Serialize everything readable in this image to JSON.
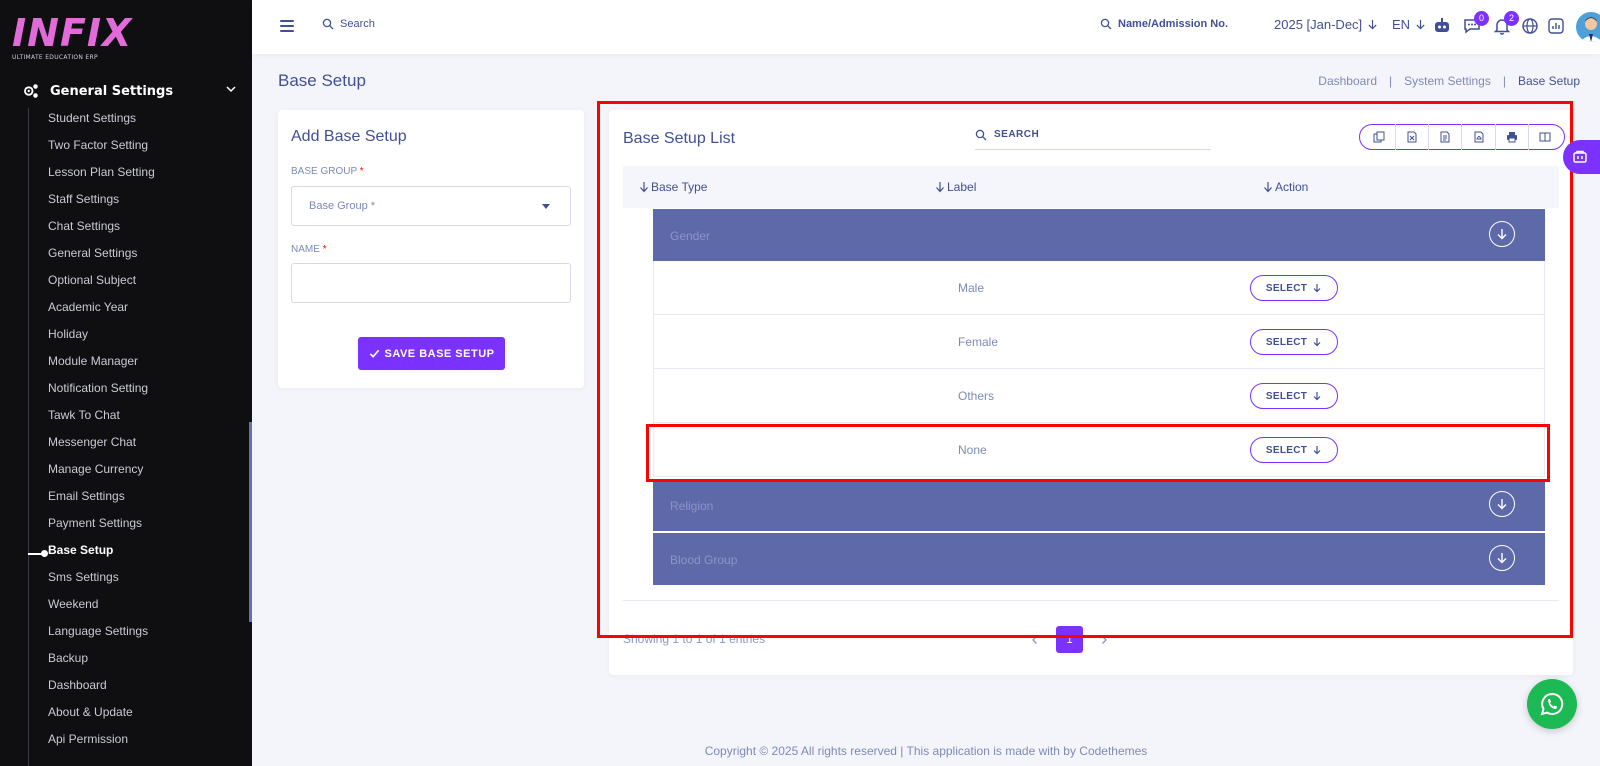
{
  "brand": {
    "name": "INFIX",
    "tagline": "ULTIMATE EDUCATION ERP"
  },
  "sidebar": {
    "section": "General Settings",
    "items": [
      {
        "label": "Student Settings"
      },
      {
        "label": "Two Factor Setting"
      },
      {
        "label": "Lesson Plan Setting"
      },
      {
        "label": "Staff Settings"
      },
      {
        "label": "Chat Settings"
      },
      {
        "label": "General Settings"
      },
      {
        "label": "Optional Subject"
      },
      {
        "label": "Academic Year"
      },
      {
        "label": "Holiday"
      },
      {
        "label": "Module Manager"
      },
      {
        "label": "Notification Setting"
      },
      {
        "label": "Tawk To Chat"
      },
      {
        "label": "Messenger Chat"
      },
      {
        "label": "Manage Currency"
      },
      {
        "label": "Email Settings"
      },
      {
        "label": "Payment Settings"
      },
      {
        "label": "Base Setup",
        "active": true
      },
      {
        "label": "Sms Settings"
      },
      {
        "label": "Weekend"
      },
      {
        "label": "Language Settings"
      },
      {
        "label": "Backup"
      },
      {
        "label": "Dashboard"
      },
      {
        "label": "About & Update"
      },
      {
        "label": "Api Permission"
      }
    ]
  },
  "topbar": {
    "search_label": "Search",
    "admission_search": "Name/Admission No.",
    "year": "2025 [Jan-Dec]",
    "lang": "EN",
    "chat_badge": "0",
    "notif_badge": "2"
  },
  "page": {
    "title": "Base Setup",
    "breadcrumb": [
      "Dashboard",
      "|",
      "System Settings",
      "|",
      "Base Setup"
    ]
  },
  "form": {
    "title": "Add Base Setup",
    "group_label": "BASE GROUP",
    "group_placeholder": "Base Group *",
    "name_label": "NAME",
    "required_mark": "*",
    "save_label": "SAVE BASE SETUP"
  },
  "list": {
    "title": "Base Setup List",
    "search_label": "SEARCH",
    "columns": [
      "Base Type",
      "Label",
      "Action"
    ],
    "groups": [
      {
        "name": "Gender",
        "items": [
          "Male",
          "Female",
          "Others",
          "None"
        ]
      },
      {
        "name": "Religion",
        "items": []
      },
      {
        "name": "Blood Group",
        "items": []
      }
    ],
    "select_label": "SELECT",
    "showing": "Showing 1 to 1 of 1 entries",
    "page": "1"
  },
  "footer": "Copyright © 2025 All rights reserved | This application is made with by Codethemes",
  "colors": {
    "accent": "#7c32ff",
    "primary": "#415094",
    "group_bg": "#5d69a8",
    "highlight": "#ff0000"
  }
}
